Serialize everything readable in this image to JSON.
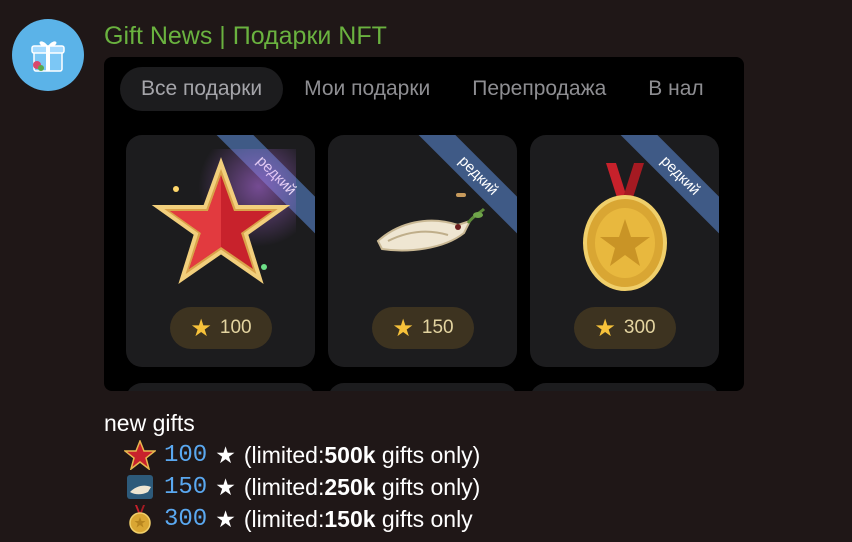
{
  "channel": {
    "name": "Gift News | Подарки NFT",
    "avatar_icon": "gift-box-icon"
  },
  "tabs": [
    {
      "label": "Все подарки",
      "active": true
    },
    {
      "label": "Мои подарки",
      "active": false
    },
    {
      "label": "Перепродажа",
      "active": false
    },
    {
      "label": "В нал",
      "active": false
    }
  ],
  "cards": [
    {
      "badge": "редкий",
      "price": "100",
      "icon": "red-star-icon"
    },
    {
      "badge": "редкий",
      "price": "150",
      "icon": "dove-icon"
    },
    {
      "badge": "редкий",
      "price": "300",
      "icon": "gold-medal-icon"
    }
  ],
  "caption": {
    "title": "new gifts",
    "lines": [
      {
        "price": "100",
        "star": "★",
        "prefix": "(limited: ",
        "amount": "500k",
        "suffix": " gifts only)"
      },
      {
        "price": "150",
        "star": "★",
        "prefix": "(limited: ",
        "amount": "250k",
        "suffix": " gifts only)"
      },
      {
        "price": "300",
        "star": "★",
        "prefix": "(limited: ",
        "amount": "150k",
        "suffix": " gifts only"
      }
    ]
  },
  "colors": {
    "channel_name": "#6ab23f",
    "price_number": "#5aa8f0",
    "ribbon": "#3f5a86",
    "background": "#1f1717"
  }
}
